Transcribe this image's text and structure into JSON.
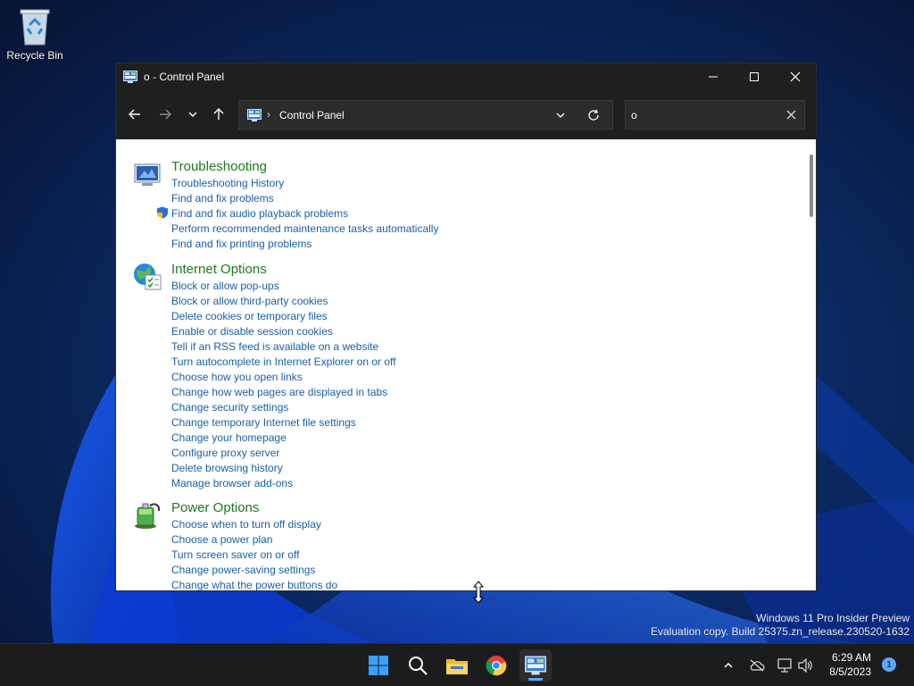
{
  "desktop": {
    "recycle_bin_label": "Recycle Bin",
    "watermark_line1": "Windows 11 Pro Insider Preview",
    "watermark_line2": "Evaluation copy. Build 25375.zn_release.230520-1632"
  },
  "window": {
    "title": "o - Control Panel",
    "breadcrumb": "Control Panel",
    "search_value": "o"
  },
  "groups": [
    {
      "title": "Troubleshooting",
      "icon": "troubleshooting-icon",
      "tasks": [
        {
          "label": "Troubleshooting History"
        },
        {
          "label": "Find and fix problems"
        },
        {
          "label": "Find and fix audio playback problems",
          "shield": true
        },
        {
          "label": "Perform recommended maintenance tasks automatically"
        },
        {
          "label": "Find and fix printing problems"
        }
      ]
    },
    {
      "title": "Internet Options",
      "icon": "internet-options-icon",
      "tasks": [
        {
          "label": "Block or allow pop-ups"
        },
        {
          "label": "Block or allow third-party cookies"
        },
        {
          "label": "Delete cookies or temporary files"
        },
        {
          "label": "Enable or disable session cookies"
        },
        {
          "label": "Tell if an RSS feed is available on a website"
        },
        {
          "label": "Turn autocomplete in Internet Explorer on or off"
        },
        {
          "label": "Choose how you open links"
        },
        {
          "label": "Change how web pages are displayed in tabs"
        },
        {
          "label": "Change security settings"
        },
        {
          "label": "Change temporary Internet file settings"
        },
        {
          "label": "Change your homepage"
        },
        {
          "label": "Configure proxy server"
        },
        {
          "label": "Delete browsing history"
        },
        {
          "label": "Manage browser add-ons"
        }
      ]
    },
    {
      "title": "Power Options",
      "icon": "power-options-icon",
      "tasks": [
        {
          "label": "Choose when to turn off display"
        },
        {
          "label": "Choose a power plan"
        },
        {
          "label": "Turn screen saver on or off"
        },
        {
          "label": "Change power-saving settings"
        },
        {
          "label": "Change what the power buttons do"
        }
      ]
    }
  ],
  "taskbar": {
    "apps": [
      "start-icon",
      "search-icon",
      "file-explorer-icon",
      "chrome-icon",
      "control-panel-icon"
    ],
    "time": "6:29 AM",
    "date": "8/5/2023",
    "notification_count": "1"
  }
}
